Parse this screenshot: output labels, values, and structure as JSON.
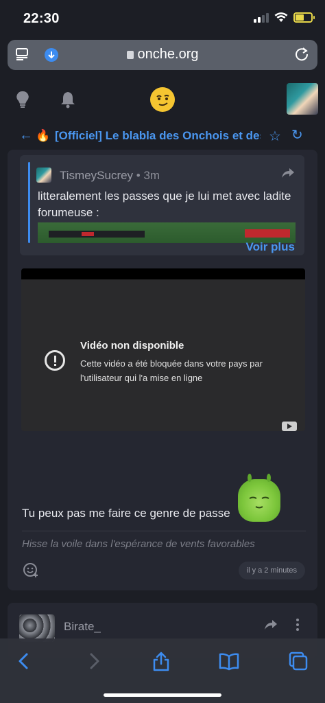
{
  "status_bar": {
    "time": "22:30"
  },
  "browser": {
    "url": "onche.org"
  },
  "topic": {
    "title": "[Officiel] Le blabla des Onchois et des"
  },
  "quote": {
    "author": "TismeySucrey",
    "separator": " • ",
    "time": "3m",
    "text": "litteralement les passes que je lui met avec ladite forumeuse :",
    "see_more": "Voir plus"
  },
  "video": {
    "title": "Vidéo non disponible",
    "message": "Cette vidéo a été bloquée dans votre pays par l'utilisateur qui l'a mise en ligne"
  },
  "post": {
    "text": "Tu peux pas me faire ce genre de passe",
    "signature": "Hisse la voile dans l'espérance de vents favorables",
    "time": "il y a 2 minutes"
  },
  "next_post": {
    "author": "Birate_"
  },
  "colors": {
    "accent": "#4a96ef",
    "background": "#1c1e25",
    "card": "#252731"
  },
  "icons": {
    "header": [
      "lightbulb-icon",
      "bell-icon",
      "logo-icon"
    ],
    "toolbar": [
      "back-icon",
      "forward-icon",
      "share-icon",
      "bookmarks-icon",
      "tabs-icon"
    ]
  }
}
